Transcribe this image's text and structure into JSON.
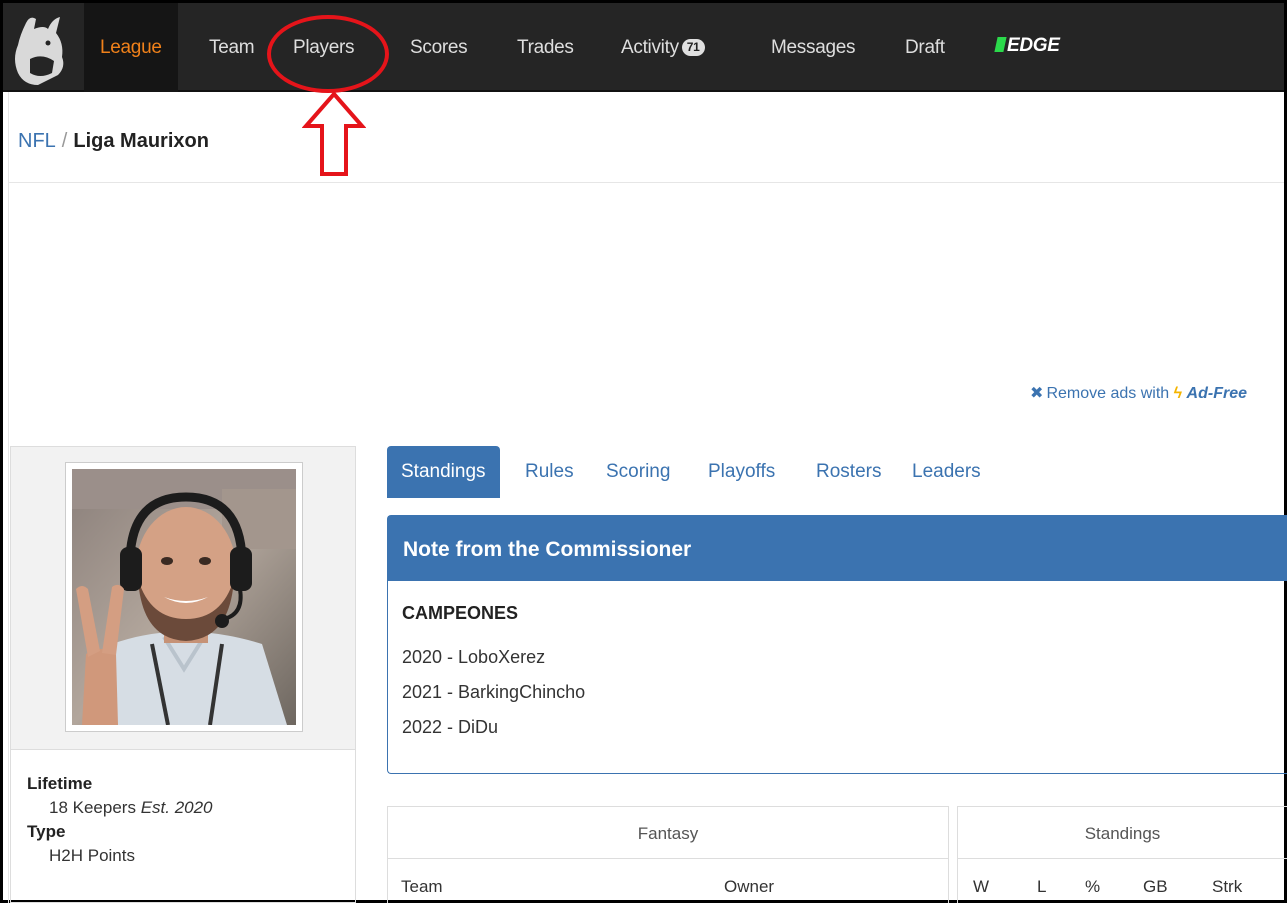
{
  "nav": {
    "items": [
      {
        "label": "League",
        "active": true
      },
      {
        "label": "Team"
      },
      {
        "label": "Players"
      },
      {
        "label": "Scores"
      },
      {
        "label": "Trades"
      },
      {
        "label": "Activity",
        "badge": "71"
      },
      {
        "label": "Messages"
      },
      {
        "label": "Draft"
      },
      {
        "label": "EDGE"
      }
    ]
  },
  "breadcrumb": {
    "root": "NFL",
    "separator": "/",
    "current": "Liga Maurixon"
  },
  "ads": {
    "remove_text": "Remove ads with",
    "ad_free": "Ad-Free"
  },
  "league_info": {
    "lifetime_label": "Lifetime",
    "lifetime_value": "18 Keepers",
    "est": "Est. 2020",
    "type_label": "Type",
    "type_value": "H2H Points"
  },
  "tabs": [
    "Standings",
    "Rules",
    "Scoring",
    "Playoffs",
    "Rosters",
    "Leaders"
  ],
  "commissioner": {
    "title": "Note from the Commissioner",
    "heading": "CAMPEONES",
    "lines": [
      "2020 - LoboXerez",
      "2021 - BarkingChincho",
      "2022 - DiDu"
    ]
  },
  "standings_table": {
    "group_fantasy": "Fantasy",
    "group_standings": "Standings",
    "columns": [
      "Team",
      "Owner",
      "W",
      "L",
      "%",
      "GB",
      "Strk"
    ]
  },
  "colors": {
    "nav_bg": "#252525",
    "active_nav": "#f0811a",
    "brand_blue": "#3b73b0",
    "annotation_red": "#e5141a",
    "edge_green": "#2bd94b"
  }
}
